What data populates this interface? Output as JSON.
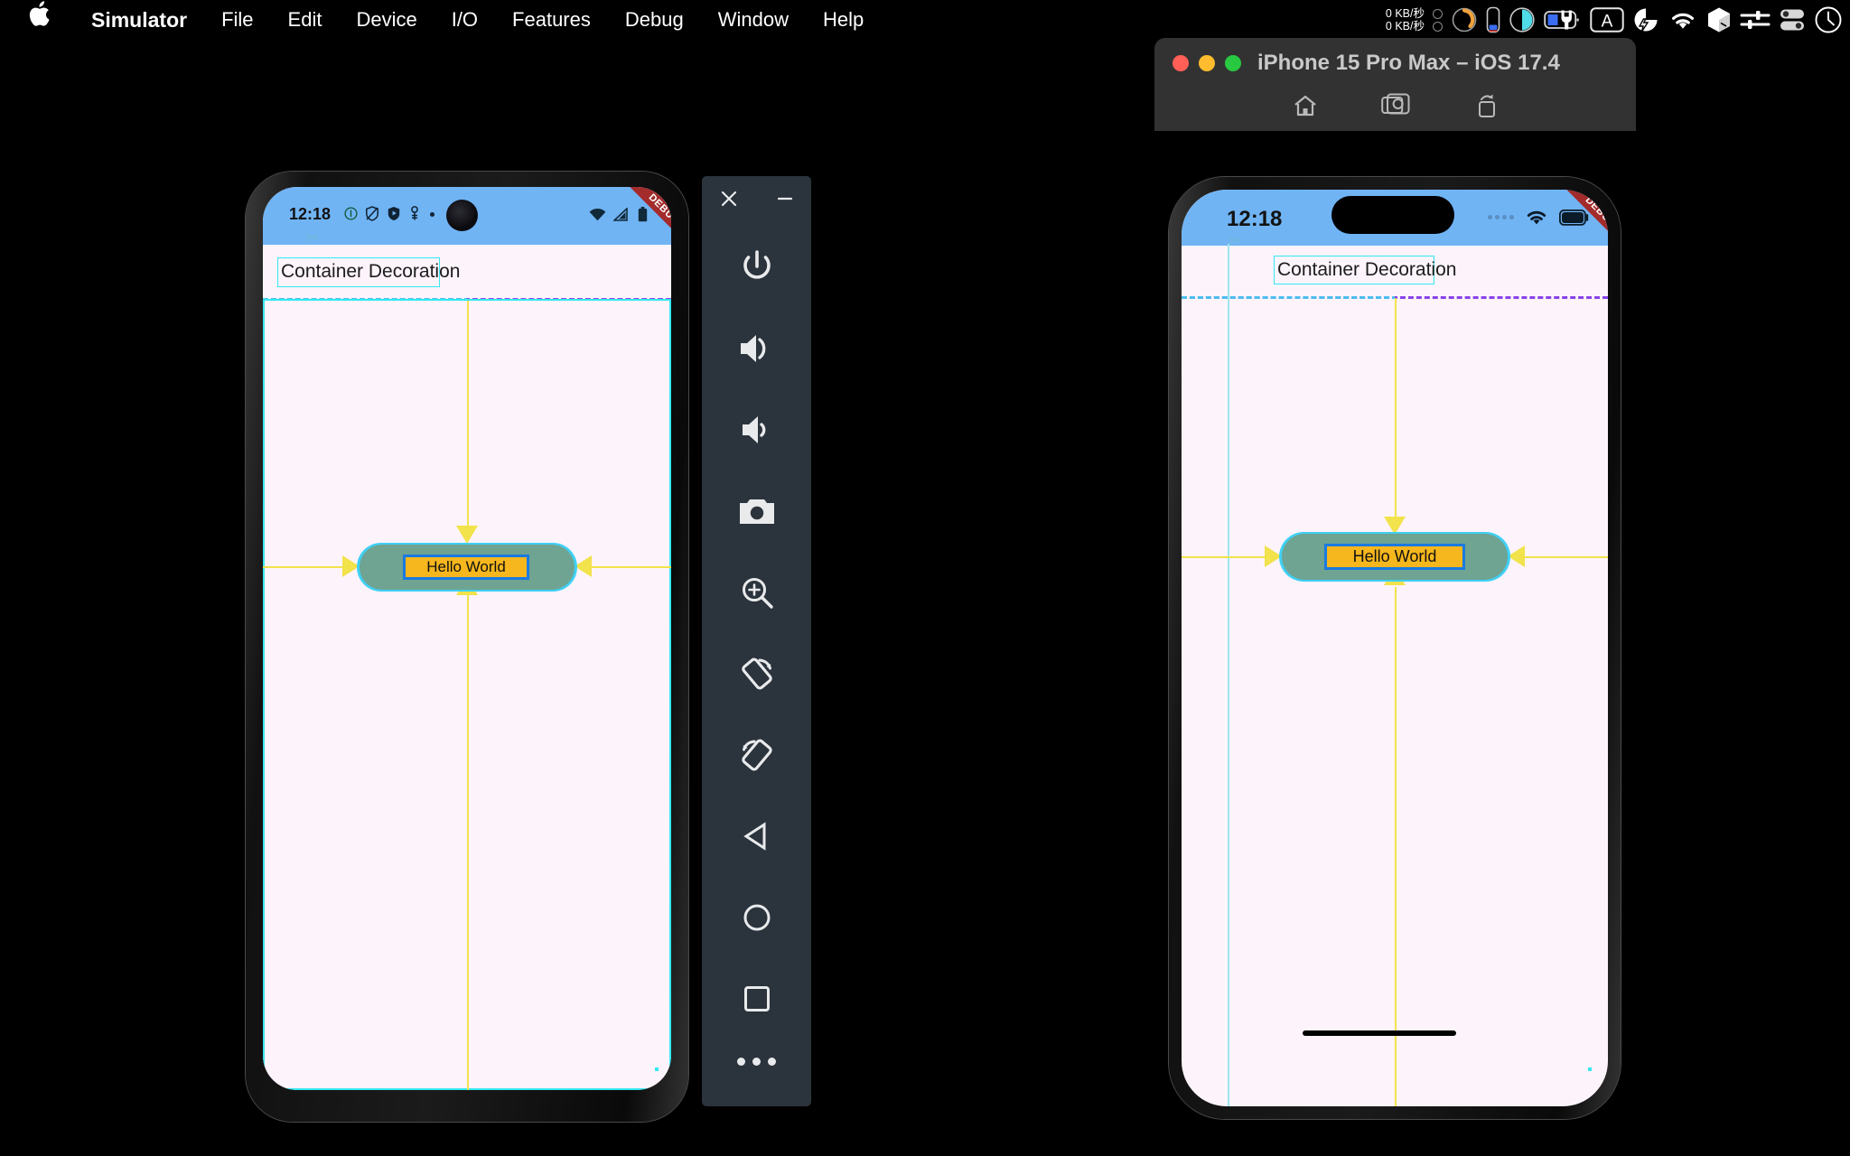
{
  "menubar": {
    "apple_logo": "",
    "items": [
      {
        "label": "Simulator",
        "bold": true
      },
      {
        "label": "File"
      },
      {
        "label": "Edit"
      },
      {
        "label": "Device"
      },
      {
        "label": "I/O"
      },
      {
        "label": "Features"
      },
      {
        "label": "Debug"
      },
      {
        "label": "Window"
      },
      {
        "label": "Help"
      }
    ],
    "status": {
      "net_up": "0 KB/秒",
      "net_down": "0 KB/秒",
      "icons": [
        "network-dots-icon",
        "cpu-gauge-icon",
        "memory-bar-icon",
        "disk-pie-icon",
        "battery-charging-icon",
        "input-source-a-icon",
        "quick-action-icon",
        "wifi-icon",
        "dropbox-icon",
        "sliders-icon",
        "control-center-icon",
        "clock-icon"
      ]
    }
  },
  "simulator_window": {
    "title": "iPhone 15 Pro Max – iOS 17.4",
    "traffic_lights": [
      "#ff5f57",
      "#febc2e",
      "#28c840"
    ],
    "toolbar_icons": [
      "home-icon",
      "screenshot-camera-icon",
      "rotate-share-icon"
    ]
  },
  "android_phone": {
    "statusbar": {
      "time": "12:18",
      "left_icons": [
        "info-circle-icon",
        "shield-off-icon",
        "shield-play-icon",
        "key-icon",
        "dot-icon"
      ],
      "right_icons": [
        "wifi-icon",
        "cellular-signal-icon",
        "battery-icon"
      ]
    },
    "debug_banner": "DEBUG",
    "app_bar_title": "Container Decoration",
    "container": {
      "text": "Hello World"
    }
  },
  "ios_phone": {
    "statusbar": {
      "time": "12:18",
      "right_icons": [
        "cellular-dots-icon",
        "wifi-icon",
        "battery-icon"
      ]
    },
    "debug_banner": "DEBUG",
    "app_bar_title": "Container Decoration",
    "container": {
      "text": "Hello World"
    }
  },
  "emulator_toolbar": {
    "window_buttons": [
      "close-icon",
      "minimize-icon"
    ],
    "buttons": [
      "power-icon",
      "volume-up-icon",
      "volume-down-icon",
      "screenshot-camera-icon",
      "zoom-in-icon",
      "rotate-left-icon",
      "rotate-right-icon",
      "back-triangle-icon",
      "home-circle-icon",
      "recents-square-icon",
      "more-dots-icon"
    ]
  },
  "colors": {
    "statusbar_blue": "#70b4f4",
    "screen_bg": "#fdf4fb",
    "debug_red": "#a32b2b",
    "debug_cyan": "#36e8f0",
    "debug_purple": "#8a42e8",
    "guide_yellow": "#f2e24b",
    "container_teal": "#6fa392",
    "label_orange": "#f5b71d",
    "label_border_blue": "#1a7ae0",
    "toolbar_bg": "#2b333c"
  }
}
